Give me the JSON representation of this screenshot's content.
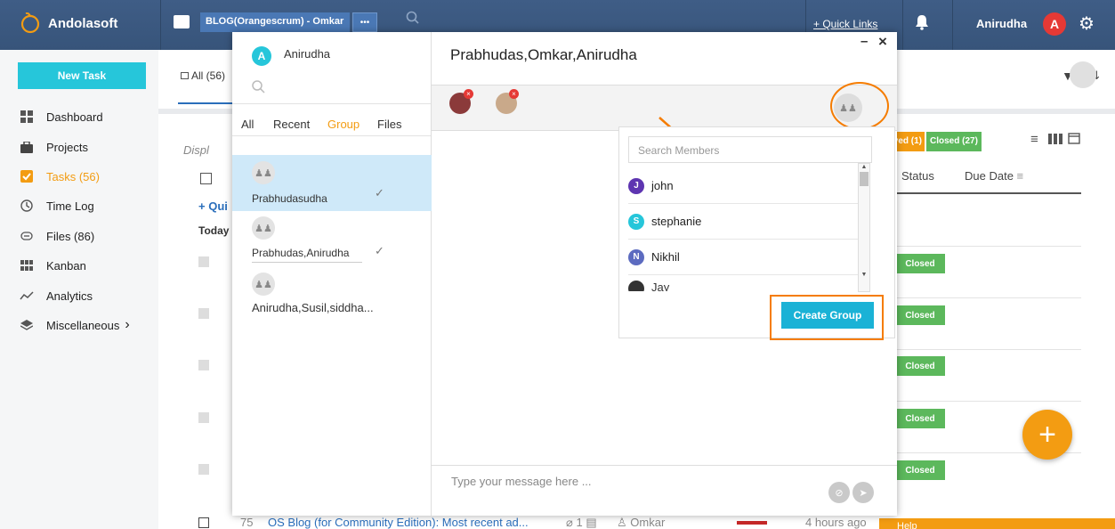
{
  "topbar": {
    "brand": "Andolasoft",
    "project": "BLOG(Orangescrum) - Omkar",
    "project_more": "•••",
    "quick_links": "+ Quick Links",
    "user_name": "Anirudha",
    "user_initial": "A"
  },
  "sidebar": {
    "new_task": "New Task",
    "items": [
      {
        "label": "Dashboard",
        "icon": "dashboard-icon"
      },
      {
        "label": "Projects",
        "icon": "briefcase-icon"
      },
      {
        "label": "Tasks (56)",
        "icon": "tasks-icon"
      },
      {
        "label": "Time Log",
        "icon": "clock-icon"
      },
      {
        "label": "Files  (86)",
        "icon": "paperclip-icon"
      },
      {
        "label": "Kanban",
        "icon": "kanban-icon"
      },
      {
        "label": "Analytics",
        "icon": "analytics-icon"
      },
      {
        "label": "Miscellaneous",
        "icon": "layers-icon"
      }
    ],
    "misc_chevron": "›"
  },
  "main": {
    "all_tab": "All (56)",
    "displ": "Displ",
    "quick": "+ Qui",
    "today": "Today",
    "resolved_badge": "lved (1)",
    "closed_badge": "Closed (27)",
    "col_status": "Status",
    "col_due": "Due Date",
    "status_closed": "Closed",
    "bottom_row": {
      "id": "75",
      "title": "OS Blog (for Community Edition): Most recent ad...",
      "attachments": "1",
      "assignee": "Omkar",
      "time": "4 hours ago",
      "help": "Help"
    }
  },
  "chat": {
    "user_name": "Anirudha",
    "user_initial": "A",
    "tabs": [
      "All",
      "Recent",
      "Group",
      "Files"
    ],
    "groups": [
      {
        "name": "Prabhudasudha",
        "check": "✓"
      },
      {
        "name": "Prabhudas,Anirudha",
        "check": "✓"
      },
      {
        "name": "Anirudha,Susil,siddha...",
        "check": ""
      }
    ],
    "title": "Prabhudas,Omkar,Anirudha",
    "minimize": "–",
    "close": "×",
    "search_placeholder": "Search Members",
    "members": [
      {
        "name": "john",
        "initial": "J",
        "color": "#5e35b1"
      },
      {
        "name": "stephanie",
        "initial": "S",
        "color": "#26c6da"
      },
      {
        "name": "Nikhil",
        "initial": "N",
        "color": "#5c6bc0"
      },
      {
        "name": "Jay",
        "initial": "",
        "color": "#333333"
      }
    ],
    "create_group": "Create Group",
    "message_placeholder": "Type your message here ..."
  }
}
